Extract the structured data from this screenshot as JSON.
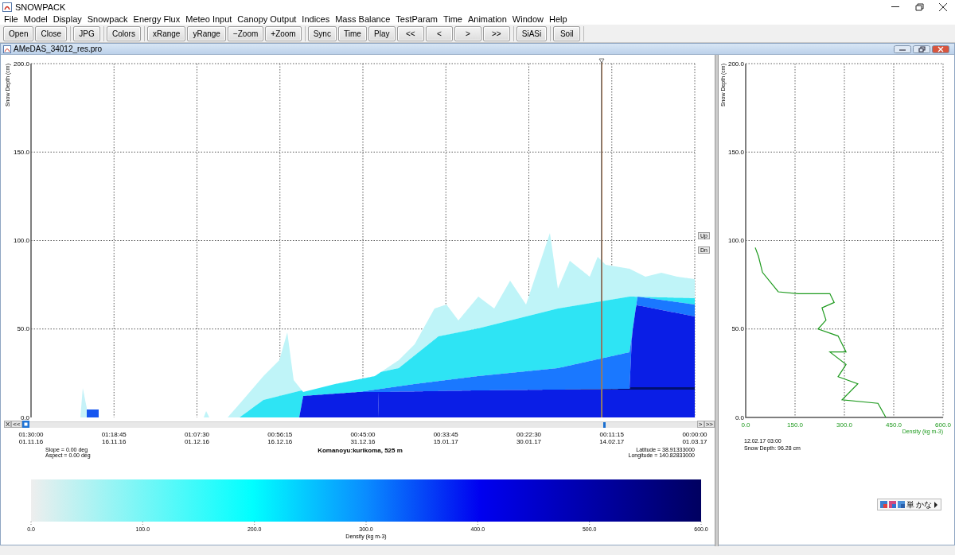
{
  "window": {
    "title": "SNOWPACK"
  },
  "menu": [
    "File",
    "Model",
    "Display",
    "Snowpack",
    "Energy Flux",
    "Meteo Input",
    "Canopy Output",
    "Indices",
    "Mass Balance",
    "TestParam",
    "Time",
    "Animation",
    "Window",
    "Help"
  ],
  "toolbar": [
    [
      "Open",
      "Close"
    ],
    [
      "JPG"
    ],
    [
      "Colors"
    ],
    [
      "xRange",
      "yRange",
      "−Zoom",
      "+Zoom"
    ],
    [
      "Sync",
      "Time",
      "Play",
      "<<",
      "<",
      ">",
      ">>"
    ],
    [
      "SiASi"
    ],
    [
      "Soil"
    ]
  ],
  "document": {
    "title": "AMeDAS_34012_res.pro"
  },
  "main_chart": {
    "ylabel": "Snow Depth (cm)",
    "yticks": [
      "200.0",
      "150.0",
      "100.0",
      "50.0",
      "0.0"
    ],
    "xticks": [
      {
        "time": "01:30:00",
        "date": "01.11.16"
      },
      {
        "time": "01:18:45",
        "date": "16.11.16"
      },
      {
        "time": "01:07:30",
        "date": "01.12.16"
      },
      {
        "time": "00:56:15",
        "date": "16.12.16"
      },
      {
        "time": "00:45:00",
        "date": "31.12.16"
      },
      {
        "time": "00:33:45",
        "date": "15.01.17"
      },
      {
        "time": "00:22:30",
        "date": "30.01.17"
      },
      {
        "time": "00:11:15",
        "date": "14.02.17"
      },
      {
        "time": "00:00:00",
        "date": "01.03.17"
      }
    ],
    "scroll_left": [
      "X",
      "<<"
    ],
    "scroll_right": [
      ">",
      ">>"
    ],
    "up_button": "Up",
    "down_button": "Dn",
    "slope": "Slope = 0.00 deg",
    "aspect": "Aspect = 0.00 deg",
    "station": "Komanoyu:kurikoma, 525 m",
    "latitude": "Latitude = 38.91333000",
    "longitude": "Longitude = 140.82833000"
  },
  "colorbar": {
    "ticks": [
      "0.0",
      "100.0",
      "200.0",
      "300.0",
      "400.0",
      "500.0",
      "600.0"
    ],
    "label": "Density (kg m-3)"
  },
  "profile": {
    "chart_data": {
      "type": "line",
      "xlabel": "Density (kg m-3)",
      "ylabel": "Snow Depth (cm)",
      "xlim": [
        0,
        600
      ],
      "ylim": [
        0,
        200
      ],
      "xticks": [
        {
          "value": 0,
          "label": "0.0"
        },
        {
          "value": 150,
          "label": "150.0"
        },
        {
          "value": 300,
          "label": "300.0"
        },
        {
          "value": 450,
          "label": "450.0"
        },
        {
          "value": 600,
          "label": "600.0"
        }
      ],
      "yticks": [
        {
          "value": 200,
          "label": "200.0"
        },
        {
          "value": 150,
          "label": "150.0"
        },
        {
          "value": 100,
          "label": "100.0"
        },
        {
          "value": 50,
          "label": "50.0"
        },
        {
          "value": 0,
          "label": "0.0"
        }
      ],
      "grid": true,
      "x": [
        29,
        39,
        51,
        99,
        160,
        256,
        269,
        232,
        244,
        220,
        281,
        305,
        256,
        305,
        281,
        341,
        293,
        402,
        426
      ],
      "series": [
        {
          "color": "#1e9a1e",
          "values": [
            96,
            91,
            82,
            71,
            70,
            70,
            65,
            62,
            55,
            50,
            46,
            37,
            37,
            30,
            23,
            19,
            10,
            8,
            0
          ]
        }
      ]
    },
    "date": "12.02.17 03:00",
    "snow_depth": "Snow Depth: 96.28 cm"
  },
  "ime_bar": {
    "labels": [
      "単",
      "かな"
    ]
  }
}
